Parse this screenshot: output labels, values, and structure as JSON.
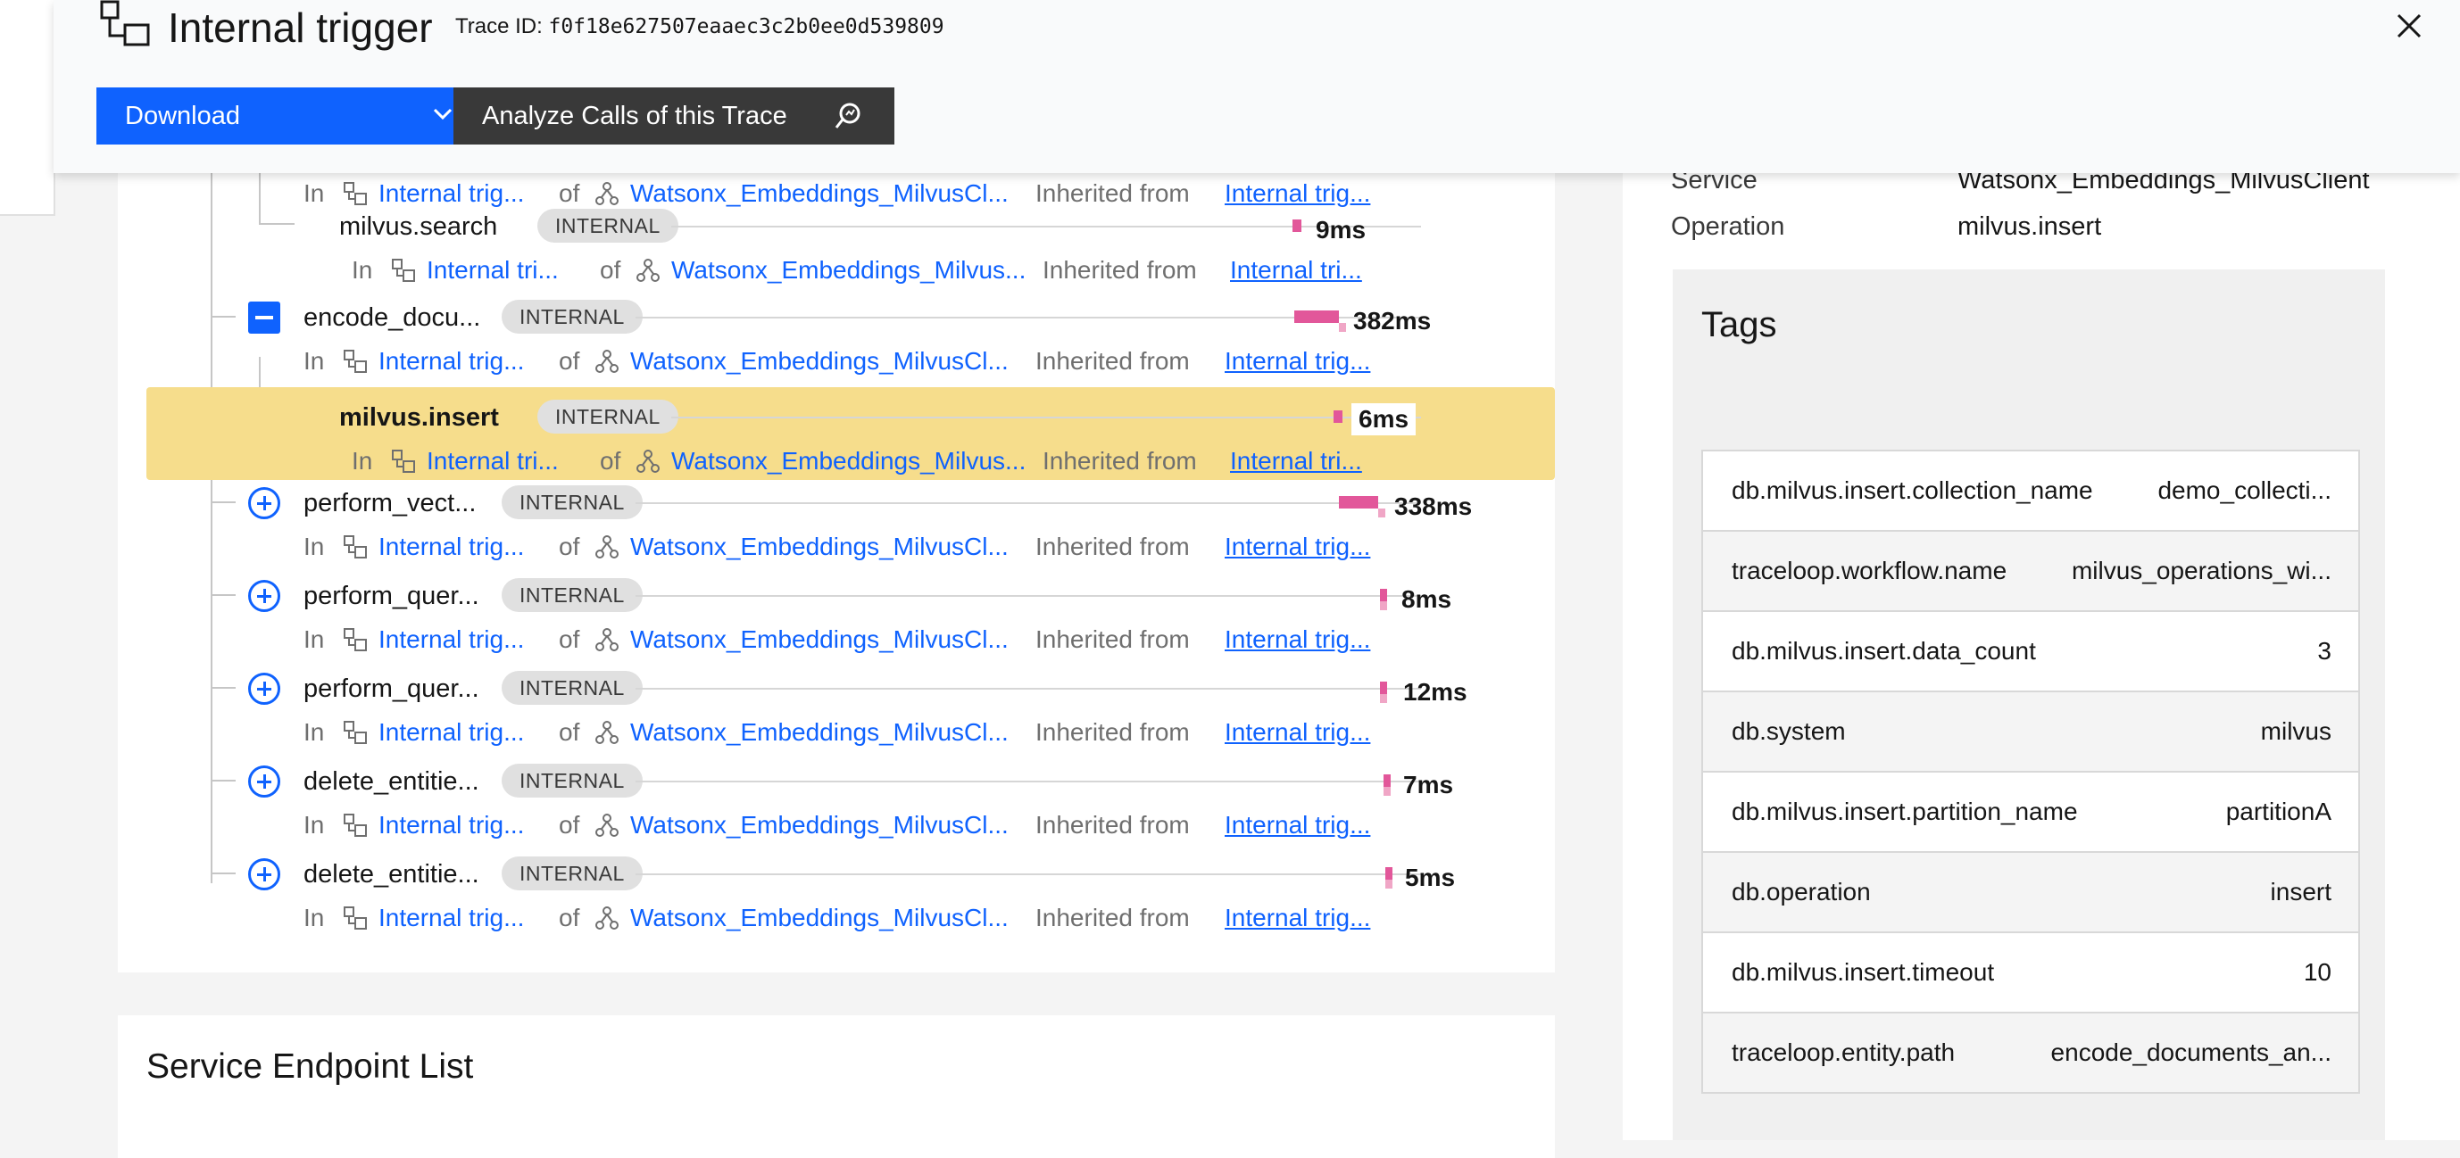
{
  "header": {
    "title": "Internal trigger",
    "trace_label": "Trace ID:",
    "trace_id": "f0f18e627507eaaec3c2b0ee0d539809",
    "download_label": "Download",
    "analyze_label": "Analyze Calls of this Trace"
  },
  "tree": {
    "rows": [
      {
        "name": "",
        "badge": "",
        "duration": "",
        "meta": {
          "in": "In",
          "call": "Internal trig...",
          "of": "of",
          "service": "Watsonx_Embeddings_MilvusCl...",
          "inherited": "Inherited from",
          "source": "Internal trig..."
        }
      },
      {
        "name": "milvus.search",
        "badge": "INTERNAL",
        "duration": "9ms",
        "meta": {
          "in": "In",
          "call": "Internal tri...",
          "of": "of",
          "service": "Watsonx_Embeddings_Milvus...",
          "inherited": "Inherited from",
          "source": "Internal tri..."
        }
      },
      {
        "name": "encode_docu...",
        "badge": "INTERNAL",
        "duration": "382ms",
        "meta": {
          "in": "In",
          "call": "Internal trig...",
          "of": "of",
          "service": "Watsonx_Embeddings_MilvusCl...",
          "inherited": "Inherited from",
          "source": "Internal trig..."
        }
      },
      {
        "name": "milvus.insert",
        "badge": "INTERNAL",
        "duration": "6ms",
        "selected": true,
        "meta": {
          "in": "In",
          "call": "Internal tri...",
          "of": "of",
          "service": "Watsonx_Embeddings_Milvus...",
          "inherited": "Inherited from",
          "source": "Internal tri..."
        }
      },
      {
        "name": "perform_vect...",
        "badge": "INTERNAL",
        "duration": "338ms",
        "meta": {
          "in": "In",
          "call": "Internal trig...",
          "of": "of",
          "service": "Watsonx_Embeddings_MilvusCl...",
          "inherited": "Inherited from",
          "source": "Internal trig..."
        }
      },
      {
        "name": "perform_quer...",
        "badge": "INTERNAL",
        "duration": "8ms",
        "meta": {
          "in": "In",
          "call": "Internal trig...",
          "of": "of",
          "service": "Watsonx_Embeddings_MilvusCl...",
          "inherited": "Inherited from",
          "source": "Internal trig..."
        }
      },
      {
        "name": "perform_quer...",
        "badge": "INTERNAL",
        "duration": "12ms",
        "meta": {
          "in": "In",
          "call": "Internal trig...",
          "of": "of",
          "service": "Watsonx_Embeddings_MilvusCl...",
          "inherited": "Inherited from",
          "source": "Internal trig..."
        }
      },
      {
        "name": "delete_entitie...",
        "badge": "INTERNAL",
        "duration": "7ms",
        "meta": {
          "in": "In",
          "call": "Internal trig...",
          "of": "of",
          "service": "Watsonx_Embeddings_MilvusCl...",
          "inherited": "Inherited from",
          "source": "Internal trig..."
        }
      },
      {
        "name": "delete_entitie...",
        "badge": "INTERNAL",
        "duration": "5ms",
        "meta": {
          "in": "In",
          "call": "Internal trig...",
          "of": "of",
          "service": "Watsonx_Embeddings_MilvusCl...",
          "inherited": "Inherited from",
          "source": "Internal trig..."
        }
      }
    ]
  },
  "endpoint_list": {
    "title": "Service Endpoint List"
  },
  "details": {
    "service_label": "Service",
    "service_value": "Watsonx_Embeddings_MilvusClient",
    "operation_label": "Operation",
    "operation_value": "milvus.insert",
    "tags_title": "Tags",
    "tags": [
      {
        "key": "db.milvus.insert.collection_name",
        "value": "demo_collecti..."
      },
      {
        "key": "traceloop.workflow.name",
        "value": "milvus_operations_wi..."
      },
      {
        "key": "db.milvus.insert.data_count",
        "value": "3"
      },
      {
        "key": "db.system",
        "value": "milvus"
      },
      {
        "key": "db.milvus.insert.partition_name",
        "value": "partitionA"
      },
      {
        "key": "db.operation",
        "value": "insert"
      },
      {
        "key": "db.milvus.insert.timeout",
        "value": "10"
      },
      {
        "key": "traceloop.entity.path",
        "value": "encode_documents_an..."
      }
    ]
  },
  "colors": {
    "accent": "#0f62fe",
    "highlight": "#f6dd8c",
    "bar": "#e2579a"
  },
  "icons": [
    "trace-icon",
    "close-icon",
    "chevron-down-icon",
    "analyze-search-icon",
    "call-icon",
    "service-icon",
    "expand-icon",
    "collapse-icon"
  ]
}
